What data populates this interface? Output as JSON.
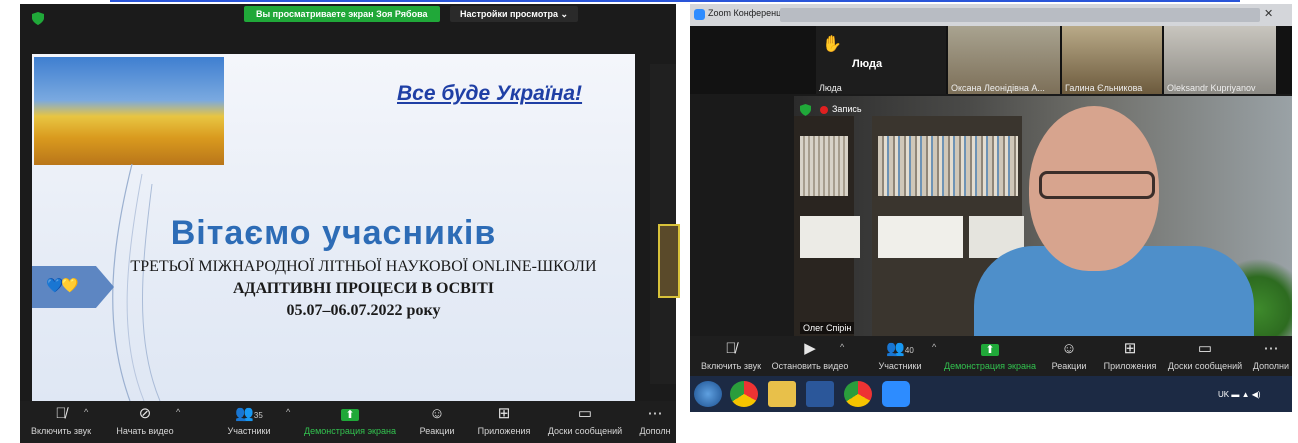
{
  "left_window": {
    "screen_share_banner": "Вы просматриваете экран Зоя Рябова",
    "view_settings": "Настройки просмотра ⌄",
    "slide": {
      "slogan": "Все буде Україна!",
      "title": "Вітаємо учасників",
      "line1": "ТРЕТЬОЇ МІЖНАРОДНОЇ ЛІТНЬОЇ НАУКОВОЇ ONLINE-ШКОЛИ",
      "line2": "АДАПТИВНІ ПРОЦЕСИ В ОСВІТІ",
      "line3": "05.07–06.07.2022 року",
      "hearts": "💙💛"
    },
    "toolbar": {
      "unmute": "Включить звук",
      "start_video": "Начать видео",
      "participants": "Участники",
      "participants_count": "35",
      "share_screen": "Демонстрация экрана",
      "reactions": "Реакции",
      "apps": "Приложения",
      "whiteboards": "Доски сообщений",
      "more": "Дополн"
    }
  },
  "right_window": {
    "title": "Zoom Конференция",
    "thumbnails": {
      "lyuda": "Люда",
      "lyuda_small": "Люда",
      "oksana": "Оксана Леонідівна А...",
      "galina": "Галина Єльникова",
      "oleksandr": "Oleksandr Kupriyanov"
    },
    "recording": "Запись",
    "speaker": "Олег Спірін",
    "toolbar": {
      "unmute": "Включить звук",
      "stop_video": "Остановить видео",
      "participants": "Участники",
      "participants_count": "40",
      "share_screen": "Демонстрация экрана",
      "reactions": "Реакции",
      "apps": "Приложения",
      "whiteboards": "Доски сообщений",
      "more": "Дополни"
    },
    "taskbar": {
      "tray_lang": "UK"
    }
  },
  "colors": {
    "zoom_green": "#20a839",
    "slide_title": "#2d6cb6",
    "slogan_blue": "#1f3fa5",
    "zoom_blue": "#2d8cff"
  }
}
